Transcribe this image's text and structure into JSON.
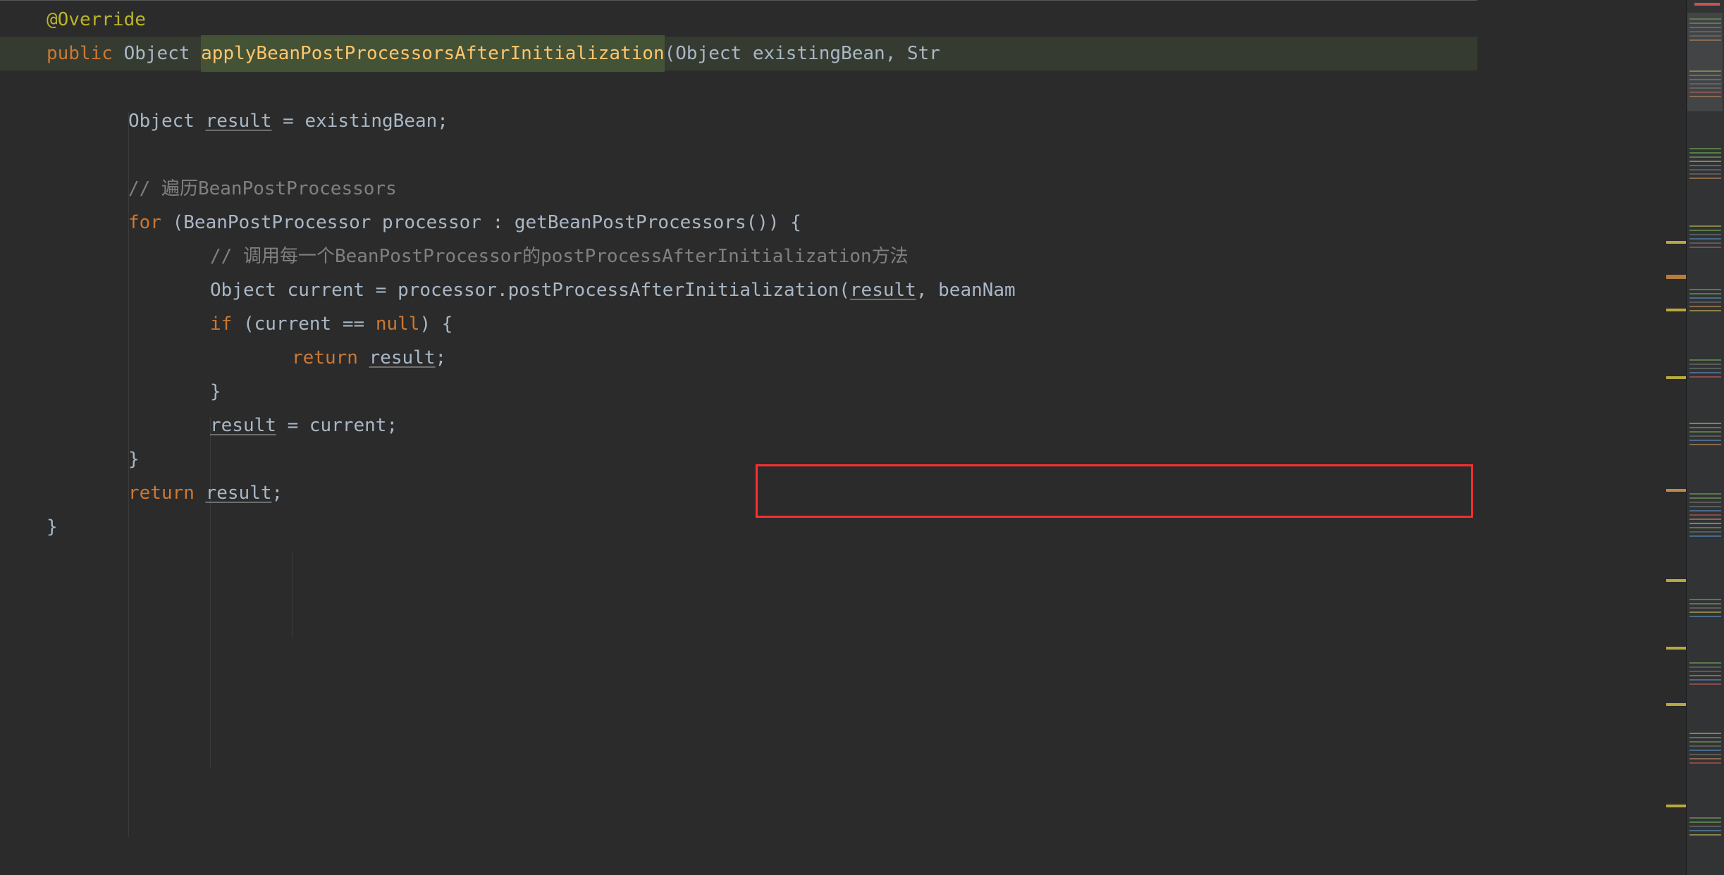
{
  "code": {
    "line1": {
      "annotation": "@Override"
    },
    "line2": {
      "kw_public": "public",
      "type_object": "Object",
      "method": "applyBeanPostProcessorsAfterInitialization",
      "lparen": "(",
      "param1_type": "Object",
      "param1_name": "existingBean",
      "comma": ", ",
      "param2_type_partial": "Str"
    },
    "line4": {
      "type": "Object ",
      "var": "result",
      "rest": " = existingBean;"
    },
    "line6": {
      "comment": "// 遍历BeanPostProcessors"
    },
    "line7": {
      "kw_for": "for",
      "pre": " (BeanPostProcessor processor : getBeanPostProcessors()) {"
    },
    "line8": {
      "comment": "// 调用每一个BeanPostProcessor的postProcessAfterInitialization方法"
    },
    "line9": {
      "pre": "Object current = processor.",
      "call": "postProcessAfterInitialization",
      "lparen": "(",
      "arg1": "result",
      "comma": ", ",
      "arg2_partial": "beanNam"
    },
    "line10": {
      "kw_if": "if",
      "cond_open": " (current == ",
      "null": "null",
      "cond_close": ") {"
    },
    "line11": {
      "kw_return": "return",
      "space": " ",
      "var": "result",
      "semi": ";"
    },
    "line12": {
      "brace": "}"
    },
    "line13": {
      "var": "result",
      "rest": " = current;"
    },
    "line14": {
      "brace": "}"
    },
    "line15": {
      "kw_return": "return",
      "space": " ",
      "var": "result",
      "semi": ";"
    },
    "line16": {
      "brace": "}"
    }
  }
}
